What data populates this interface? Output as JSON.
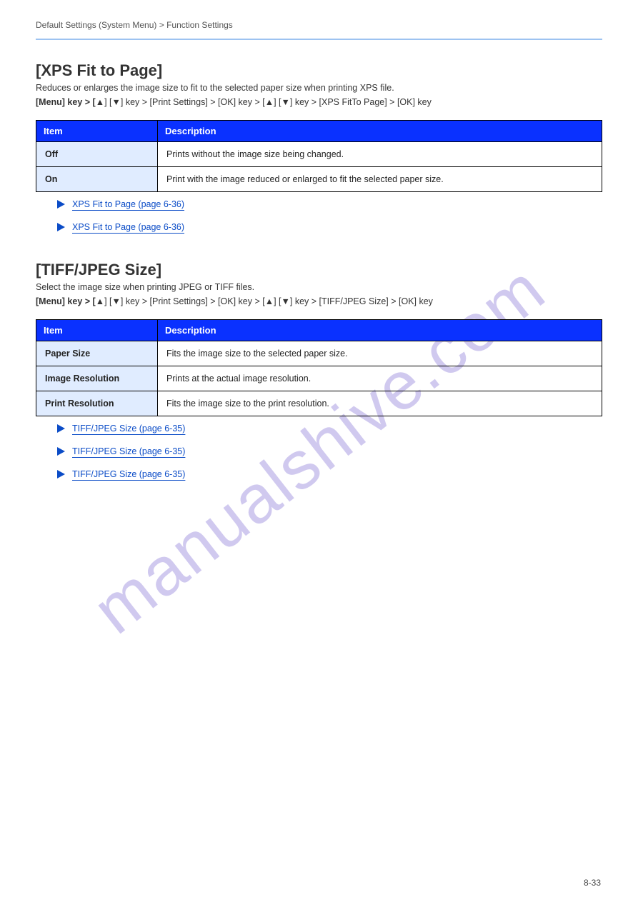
{
  "header": {
    "left": "Default Settings (System Menu) > Function Settings",
    "right": ""
  },
  "section1": {
    "title": "[XPS Fit to Page]",
    "desc": "Reduces or enlarges the image size to fit to the selected paper size when printing XPS file.",
    "config_label": "[Menu] key > [",
    "config_up": "▲",
    "config_down": "▼",
    "config_path": "] key > [Print Settings] > [OK] key > [",
    "config_path2": "] key > [XPS FitTo Page] > [OK] key",
    "table": {
      "th1": "Item",
      "th2": "Description",
      "rows": [
        {
          "k": "Off",
          "v": "Prints without the image size being changed."
        },
        {
          "k": "On",
          "v": "Print with the image reduced or enlarged to fit the selected paper size."
        }
      ]
    },
    "links": [
      "XPS Fit to Page (page 6-36)",
      "XPS Fit to Page (page 6-36)"
    ]
  },
  "section2": {
    "title": "[TIFF/JPEG Size]",
    "desc": "Select the image size when printing JPEG or TIFF files.",
    "config_label": "[Menu] key > [",
    "config_up": "▲",
    "config_down": "▼",
    "config_path": "] key > [Print Settings] > [OK] key > [",
    "config_path2": "] key > [TIFF/JPEG Size] > [OK] key",
    "table": {
      "th1": "Item",
      "th2": "Description",
      "rows": [
        {
          "k": "Paper Size",
          "v": "Fits the image size to the selected paper size."
        },
        {
          "k": "Image Resolution",
          "v": "Prints at the actual image resolution."
        },
        {
          "k": "Print Resolution",
          "v": "Fits the image size to the print resolution."
        }
      ]
    },
    "links": [
      "TIFF/JPEG Size (page 6-35)",
      "TIFF/JPEG Size (page 6-35)",
      "TIFF/JPEG Size (page 6-35)"
    ]
  },
  "pageNumber": "8-33",
  "watermark": "manualshive.com"
}
